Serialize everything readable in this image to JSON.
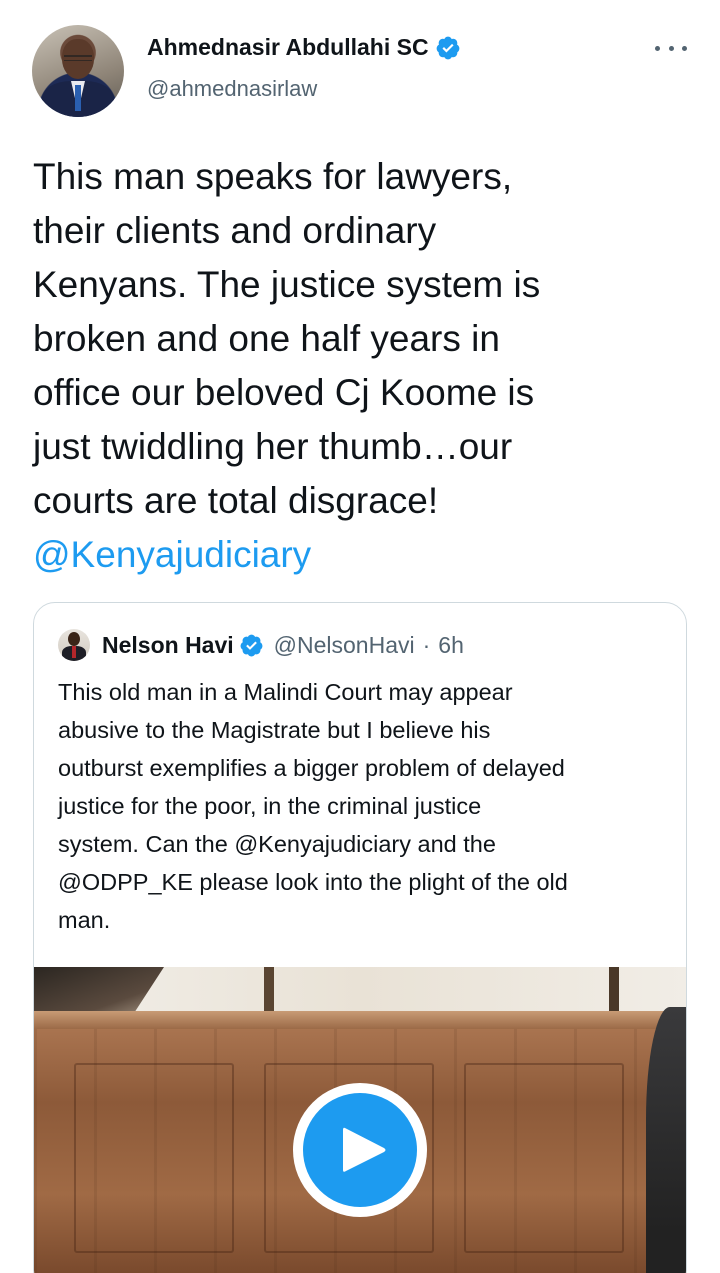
{
  "tweet": {
    "author": {
      "display_name": "Ahmednasir Abdullahi SC",
      "handle": "@ahmednasirlaw",
      "verified": true
    },
    "text_lines": [
      "This man speaks for lawyers,",
      "their clients and ordinary",
      "Kenyans. The justice system is",
      "broken and one half years in",
      "office our beloved Cj Koome is",
      "just twiddling her thumb…our",
      "courts are total disgrace!"
    ],
    "mention": "@Kenyajudiciary",
    "menu_icon": "more-horizontal-icon"
  },
  "quoted_tweet": {
    "author": {
      "display_name": "Nelson Havi",
      "handle": "@NelsonHavi",
      "verified": true
    },
    "separator": "·",
    "time": "6h",
    "text_lines": [
      "This old man in a Malindi Court may appear",
      "abusive to the Magistrate but I believe his",
      "outburst exemplifies a bigger problem of delayed",
      "justice for the poor, in the criminal justice",
      "system. Can the @Kenyajudiciary and the",
      "@ODPP_KE please look into the plight of the old",
      "man."
    ],
    "media": {
      "type": "video",
      "icon": "play-icon"
    }
  },
  "colors": {
    "accent": "#1d9bf0",
    "text": "#0f1419",
    "secondary": "#536471",
    "border": "#cfd9de"
  }
}
